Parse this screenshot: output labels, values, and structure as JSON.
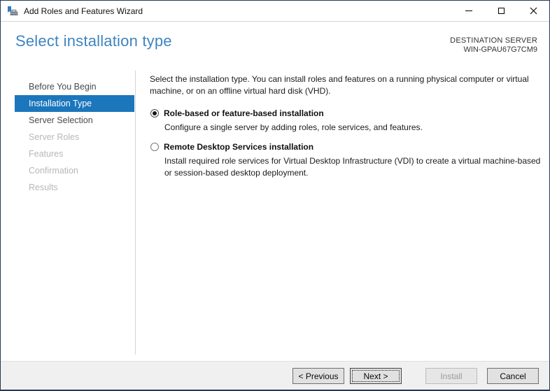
{
  "window": {
    "title": "Add Roles and Features Wizard",
    "icons": {
      "app": "server-manager-toolbox-icon",
      "minimize": "minimize-icon",
      "maximize": "maximize-icon",
      "close": "close-icon"
    }
  },
  "header": {
    "title": "Select installation type",
    "destination_label": "DESTINATION SERVER",
    "destination_server": "WIN-GPAU67G7CM9"
  },
  "sidebar": {
    "items": [
      {
        "label": "Before You Begin",
        "state": "enabled"
      },
      {
        "label": "Installation Type",
        "state": "selected"
      },
      {
        "label": "Server Selection",
        "state": "enabled"
      },
      {
        "label": "Server Roles",
        "state": "disabled"
      },
      {
        "label": "Features",
        "state": "disabled"
      },
      {
        "label": "Confirmation",
        "state": "disabled"
      },
      {
        "label": "Results",
        "state": "disabled"
      }
    ]
  },
  "main": {
    "intro_lines": [
      "Select the installation type. You can install roles and features on a running physical computer or virtual",
      "machine, or on an offline virtual hard disk (VHD)."
    ],
    "options": [
      {
        "label": "Role-based or feature-based installation",
        "selected": true,
        "description_lines": [
          "Configure a single server by adding roles, role services, and features."
        ]
      },
      {
        "label": "Remote Desktop Services installation",
        "selected": false,
        "description_lines": [
          "Install required role services for Virtual Desktop Infrastructure (VDI) to create a virtual machine-based",
          "or session-based desktop deployment."
        ]
      }
    ]
  },
  "footer": {
    "buttons": [
      {
        "label": "< Previous",
        "state": "enabled"
      },
      {
        "label": "Next >",
        "state": "focused-default"
      },
      {
        "label": "Install",
        "state": "disabled"
      },
      {
        "label": "Cancel",
        "state": "enabled"
      }
    ]
  },
  "colors": {
    "accent_selection": "#1c76bc",
    "heading_blue": "#3e85bf",
    "window_border": "#24395a",
    "footer_bg": "#f0f0f0"
  }
}
